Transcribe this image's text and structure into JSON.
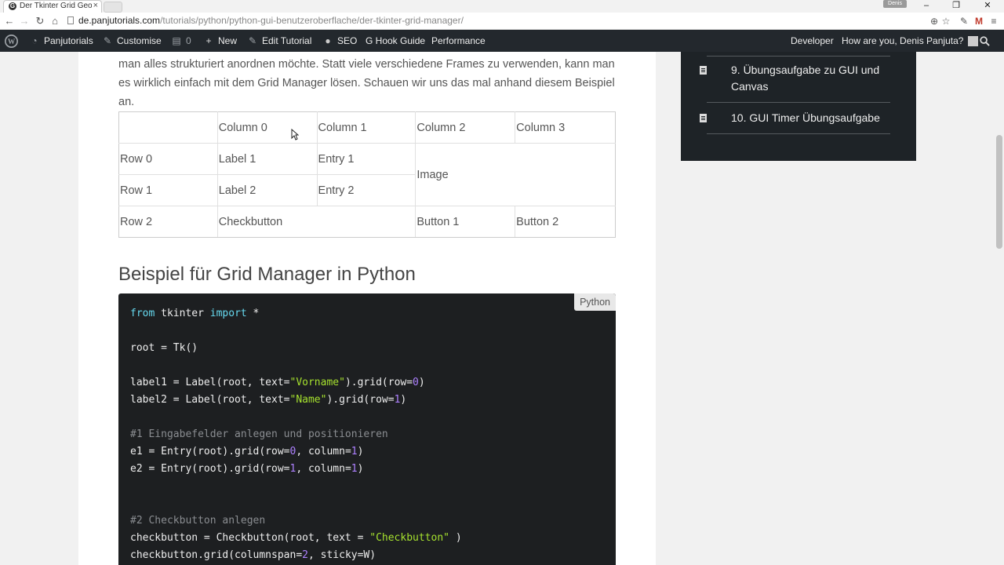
{
  "browser": {
    "tab_title": "Der Tkinter Grid Geo",
    "tab_favicon": "G",
    "user_badge": "Denis",
    "url_host": "de.panjutorials.com",
    "url_path": "/tutorials/python/python-gui-benutzeroberflache/der-tkinter-grid-manager/"
  },
  "adminbar": {
    "site_name": "Panjutorials",
    "customise": "Customise",
    "comments_count": "0",
    "new": "New",
    "edit": "Edit Tutorial",
    "seo": "SEO",
    "hook_guide": "G Hook Guide",
    "performance": "Performance",
    "developer": "Developer",
    "greeting": "How are you, Denis Panjuta?"
  },
  "article": {
    "intro_text": "man alles strukturiert anordnen möchte. Statt viele verschiedene Frames zu verwenden, kann man es wirklich einfach mit dem Grid Manager lösen. Schauen wir uns das mal anhand diesem Beispiel an.",
    "grid_table": {
      "header": [
        "",
        "Column 0",
        "Column 1",
        "Column 2",
        "Column 3"
      ],
      "row0": [
        "Row 0",
        "Label 1",
        "Entry 1",
        "Image"
      ],
      "row1": [
        "Row 1",
        "Label 2",
        "Entry 2"
      ],
      "row2": [
        "Row 2",
        "Checkbutton",
        "Button 1",
        "Button 2"
      ]
    },
    "heading": "Beispiel für Grid Manager in Python",
    "code_language": "Python",
    "code_lines": [
      [
        {
          "t": "from",
          "c": "kw"
        },
        {
          "t": " tkinter "
        },
        {
          "t": "import",
          "c": "kw"
        },
        {
          "t": " *"
        }
      ],
      [],
      [
        {
          "t": "root = Tk()"
        }
      ],
      [],
      [
        {
          "t": "label1 = Label(root, text="
        },
        {
          "t": "\"Vorname\"",
          "c": "str"
        },
        {
          "t": ").grid(row="
        },
        {
          "t": "0",
          "c": "num"
        },
        {
          "t": ")"
        }
      ],
      [
        {
          "t": "label2 = Label(root, text="
        },
        {
          "t": "\"Name\"",
          "c": "str"
        },
        {
          "t": ").grid(row="
        },
        {
          "t": "1",
          "c": "num"
        },
        {
          "t": ")"
        }
      ],
      [],
      [
        {
          "t": "#1 Eingabefelder anlegen und positionieren",
          "c": "cm"
        }
      ],
      [
        {
          "t": "e1 = Entry(root).grid(row="
        },
        {
          "t": "0",
          "c": "num"
        },
        {
          "t": ", column="
        },
        {
          "t": "1",
          "c": "num"
        },
        {
          "t": ")"
        }
      ],
      [
        {
          "t": "e2 = Entry(root).grid(row="
        },
        {
          "t": "1",
          "c": "num"
        },
        {
          "t": ", column="
        },
        {
          "t": "1",
          "c": "num"
        },
        {
          "t": ")"
        }
      ],
      [],
      [],
      [
        {
          "t": "#2 Checkbutton anlegen",
          "c": "cm"
        }
      ],
      [
        {
          "t": "checkbutton = Checkbutton(root, text = "
        },
        {
          "t": "\"Checkbutton\"",
          "c": "str"
        },
        {
          "t": " )"
        }
      ],
      [
        {
          "t": "checkbutton.grid(columnspan="
        },
        {
          "t": "2",
          "c": "num"
        },
        {
          "t": ", sticky=W)"
        }
      ]
    ]
  },
  "sidebar": {
    "items": [
      {
        "label": "9. Übungsaufgabe zu GUI und Canvas",
        "icon": "document-icon"
      },
      {
        "label": "10. GUI Timer Übungsaufgabe",
        "icon": "document-icon"
      }
    ]
  },
  "colors": {
    "adminbar_bg": "#23282d",
    "code_bg": "#1d1f21",
    "keyword": "#66d9ef",
    "string": "#a6e22e",
    "number": "#ae81ff",
    "comment": "#8a8d91",
    "sidebar_bg": "#1e2327"
  }
}
